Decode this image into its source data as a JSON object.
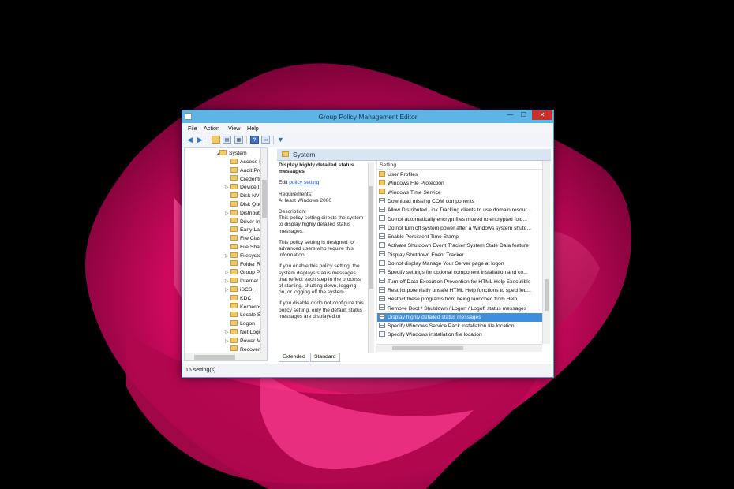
{
  "window": {
    "title": "Group Policy Management Editor",
    "controls": {
      "minimize": "—",
      "maximize": "☐",
      "close": "✕"
    }
  },
  "menu": [
    "File",
    "Action",
    "View",
    "Help"
  ],
  "toolbar": {
    "icons": [
      "back-arrow-icon",
      "forward-arrow-icon",
      "folder-up-icon",
      "show-tree-icon",
      "export-list-icon",
      "help-icon",
      "properties-icon",
      "filter-icon"
    ]
  },
  "tree": {
    "parent": "System",
    "items": [
      {
        "label": "Access-De",
        "expandable": false
      },
      {
        "label": "Audit Proc",
        "expandable": false
      },
      {
        "label": "Credential",
        "expandable": false
      },
      {
        "label": "Device Ins",
        "expandable": true
      },
      {
        "label": "Disk NV C",
        "expandable": false
      },
      {
        "label": "Disk Quot",
        "expandable": false
      },
      {
        "label": "Distribute",
        "expandable": true
      },
      {
        "label": "Driver Inst",
        "expandable": false
      },
      {
        "label": "Early Laun",
        "expandable": false
      },
      {
        "label": "File Classi",
        "expandable": false
      },
      {
        "label": "File Share",
        "expandable": false
      },
      {
        "label": "Filesystem",
        "expandable": true
      },
      {
        "label": "Folder Red",
        "expandable": false
      },
      {
        "label": "Group Pol",
        "expandable": true
      },
      {
        "label": "Internet C",
        "expandable": true
      },
      {
        "label": "iSCSI",
        "expandable": true
      },
      {
        "label": "KDC",
        "expandable": false
      },
      {
        "label": "Kerberos",
        "expandable": false
      },
      {
        "label": "Locale Ser",
        "expandable": false
      },
      {
        "label": "Logon",
        "expandable": false
      },
      {
        "label": "Net Logon",
        "expandable": true
      },
      {
        "label": "Power Ma",
        "expandable": true
      },
      {
        "label": "Recovery",
        "expandable": false
      }
    ]
  },
  "details": {
    "header": "System",
    "policy_title": "Display highly detailed status messages",
    "edit_prefix": "Edit",
    "edit_link": "policy setting",
    "requirements_label": "Requirements:",
    "requirements_value": "At least Windows 2000",
    "description_label": "Description:",
    "p1": "This policy setting directs the system to display highly detailed status messages.",
    "p2": "This policy setting is designed for advanced users who require this information.",
    "p3": "If you enable this policy setting, the system displays status messages that reflect each step in the process of starting, shutting down, logging on, or logging off the system.",
    "p4": "If you disable or do not configure this policy setting, only the default status messages are displayed to"
  },
  "list": {
    "column": "Setting",
    "items": [
      {
        "label": "User Profiles",
        "type": "folder"
      },
      {
        "label": "Windows File Protection",
        "type": "folder"
      },
      {
        "label": "Windows Time Service",
        "type": "folder"
      },
      {
        "label": "Download missing COM components",
        "type": "policy"
      },
      {
        "label": "Allow Distributed Link Tracking clients to use domain resour...",
        "type": "policy"
      },
      {
        "label": "Do not automatically encrypt files moved to encrypted fold...",
        "type": "policy"
      },
      {
        "label": "Do not turn off system power after a Windows system shutd...",
        "type": "policy"
      },
      {
        "label": "Enable Persistent Time Stamp",
        "type": "policy"
      },
      {
        "label": "Activate Shutdown Event Tracker System State Data feature",
        "type": "policy"
      },
      {
        "label": "Display Shutdown Event Tracker",
        "type": "policy"
      },
      {
        "label": "Do not display Manage Your Server page at logon",
        "type": "policy"
      },
      {
        "label": "Specify settings for optional component installation and co...",
        "type": "policy"
      },
      {
        "label": "Turn off Data Execution Prevention for HTML Help Executible",
        "type": "policy"
      },
      {
        "label": "Restrict potentially unsafe HTML Help functions to specified...",
        "type": "policy"
      },
      {
        "label": "Restrict these programs from being launched from Help",
        "type": "policy"
      },
      {
        "label": "Remove Boot / Shutdown / Logon / Logoff status messages",
        "type": "policy"
      },
      {
        "label": "Display highly detailed status messages",
        "type": "policy",
        "selected": true
      },
      {
        "label": "Specify Windows Service Pack installation file location",
        "type": "policy"
      },
      {
        "label": "Specify Windows installation file location",
        "type": "policy"
      }
    ]
  },
  "tabs": [
    "Extended",
    "Standard"
  ],
  "status": "16 setting(s)",
  "colors": {
    "titlebar": "#5eb4e6",
    "selection": "#3f8fdc",
    "wallpaper_accent": "#e0116e"
  }
}
